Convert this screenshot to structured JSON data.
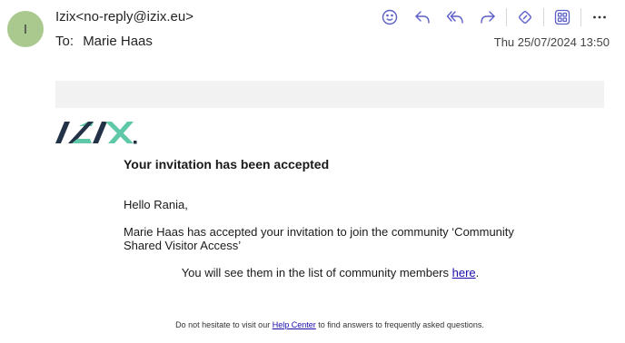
{
  "avatar": {
    "initial": "I",
    "color": "#a9c98e"
  },
  "header": {
    "sender": "Izix<no-reply@izix.eu>",
    "to_label": "To:",
    "recipient": "Marie Haas",
    "date": "Thu 25/07/2024 13:50"
  },
  "toolbar": {
    "icons": [
      "smiley-icon",
      "reply-icon",
      "reply-all-icon",
      "forward-icon",
      "apps-addin-icon",
      "grid-addin-icon",
      "more-icon"
    ],
    "accent_color": "#5b5fc7"
  },
  "logo": {
    "text": "IZIX",
    "dark_color": "#233246",
    "accent_color": "#5fc8a8"
  },
  "email": {
    "heading": "Your invitation has been accepted",
    "greeting": "Hello Rania,",
    "message": "Marie Haas has accepted your invitation to join the community ‘Community Shared Visitor Access’",
    "members_prefix": "You will see them in the list of community members ",
    "members_link": "here",
    "members_suffix": "."
  },
  "footer": {
    "prefix": "Do not hesitate to visit our ",
    "link": "Help Center",
    "suffix": " to find answers to frequently asked questions."
  }
}
